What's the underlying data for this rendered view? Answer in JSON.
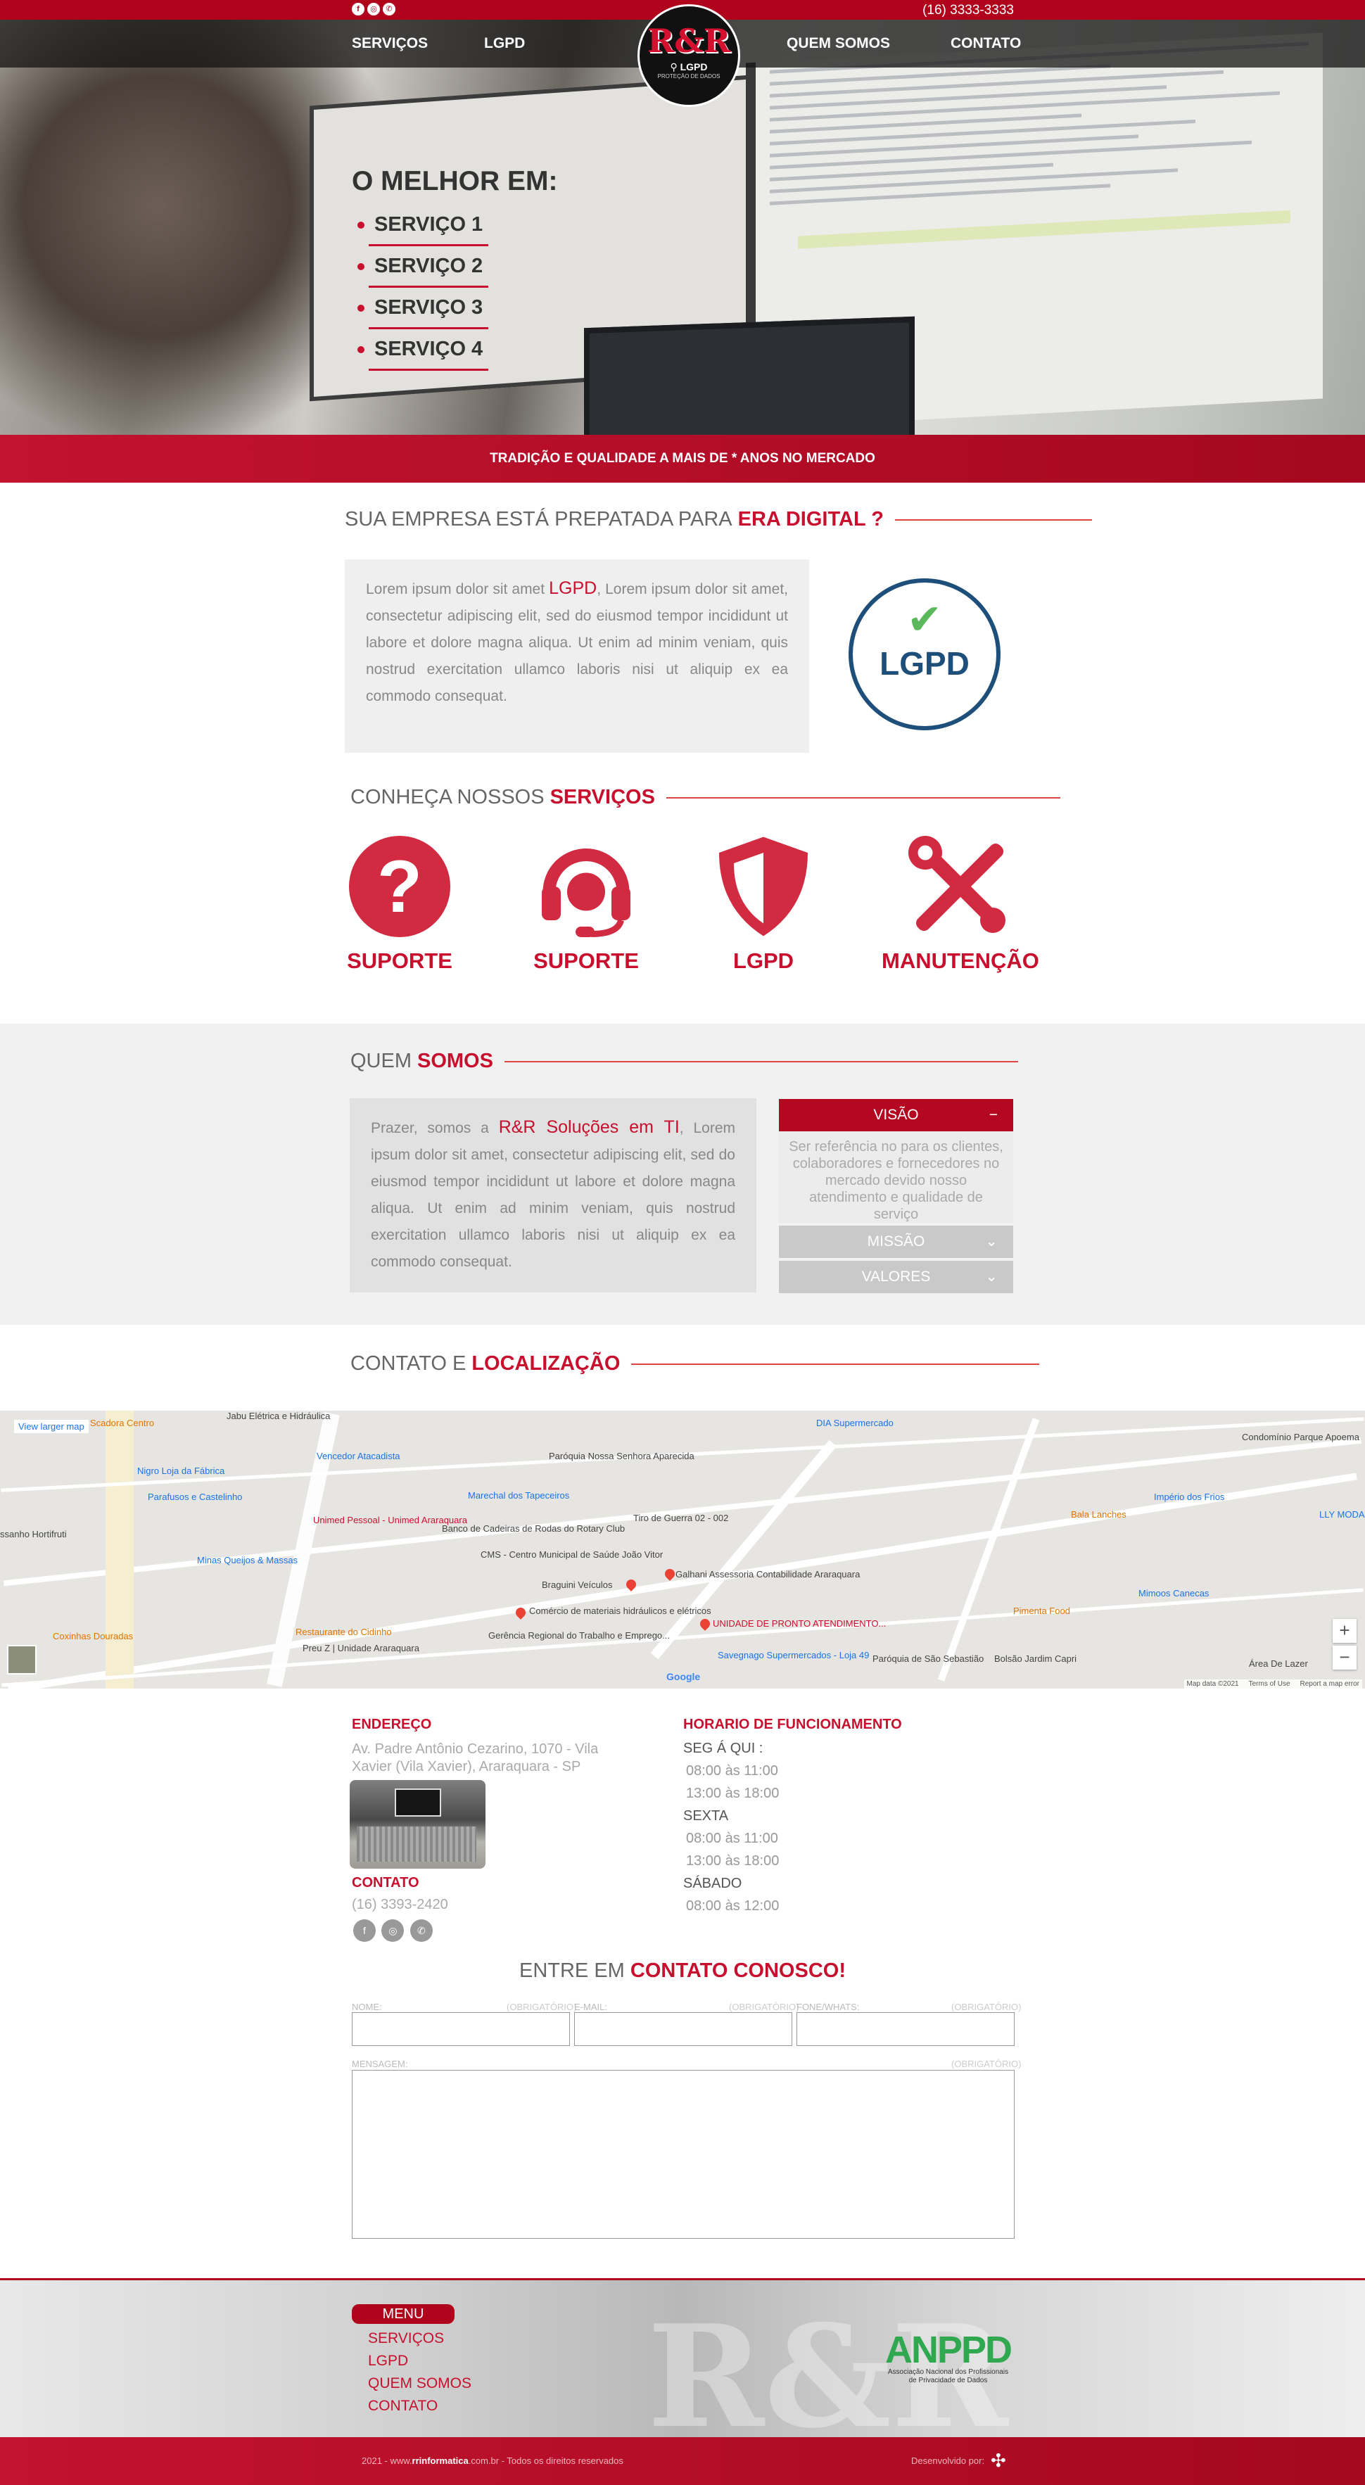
{
  "topbar": {
    "phone": "(16) 3333-3333",
    "social": [
      "f",
      "◎",
      "✆"
    ]
  },
  "nav": {
    "items": [
      "SERVIÇOS",
      "LGPD",
      "QUEM SOMOS",
      "CONTATO"
    ],
    "logo": {
      "mark": "R&R",
      "sub": "⚲ LGPD",
      "tag": "PROTEÇÃO DE DADOS"
    }
  },
  "hero": {
    "title": "O MELHOR EM:",
    "services": [
      "SERVIÇO 1",
      "SERVIÇO 2",
      "SERVIÇO 3",
      "SERVIÇO 4"
    ]
  },
  "tagline": "TRADIÇÃO E QUALIDADE A MAIS DE * ANOS NO MERCADO",
  "lgpd_section": {
    "heading": "SUA EMPRESA ESTÁ PREPATADA PARA",
    "heading_hl": "ERA DIGITAL ?",
    "text_pre": "Lorem ipsum dolor sit amet ",
    "text_hl": "LGPD",
    "text_post": ", Lorem ipsum dolor sit amet, consectetur adipiscing elit, sed do eiusmod tempor incididunt ut labore et dolore magna aliqua. Ut enim ad minim veniam, quis nostrud exercitation ullamco laboris nisi ut aliquip ex ea commodo consequat.",
    "badge_check": "✔",
    "badge_text": "LGPD"
  },
  "services_section": {
    "heading": "CONHEÇA NOSSOS",
    "heading_hl": "SERVIÇOS",
    "items": [
      {
        "label": "SUPORTE",
        "icon": "question-icon"
      },
      {
        "label": "SUPORTE",
        "icon": "headset-icon"
      },
      {
        "label": "LGPD",
        "icon": "shield-icon"
      },
      {
        "label": "MANUTENÇÃO",
        "icon": "tools-icon"
      }
    ]
  },
  "about": {
    "heading": "QUEM",
    "heading_hl": "SOMOS",
    "text_pre": "Prazer, somos a ",
    "text_hl": "R&R Soluções em TI",
    "text_post": ", Lorem ipsum dolor sit amet, consectetur adipiscing elit, sed do eiusmod tempor incididunt ut labore et dolore magna aliqua. Ut enim ad minim veniam, quis nostrud exercitation ullamco laboris nisi ut aliquip ex ea commodo consequat.",
    "accordion": [
      {
        "title": "VISÃO",
        "symbol": "−",
        "body": "Ser referência no para os clientes, colaboradores e fornecedores no mercado devido nosso atendimento e qualidade de serviço"
      },
      {
        "title": "MISSÃO",
        "symbol": "⌄"
      },
      {
        "title": "VALORES",
        "symbol": "⌄"
      }
    ]
  },
  "contact_heading": {
    "pre": "CONTATO E",
    "hl": "LOCALIZAÇÃO"
  },
  "map": {
    "view_larger": "View larger map",
    "labels": [
      "Jabu Elétrica e Hidráulica",
      "Vencedor Atacadista",
      "Nigro Loja da Fábrica",
      "Parafusos e Castelinho",
      "Paróquia Nossa Senhora Aparecida",
      "Marechal dos Tapeceiros",
      "Unimed Pessoal - Unimed Araraquara",
      "Banco de Cadeiras de Rodas do Rotary Club",
      "Tiro de Guerra 02 - 002",
      "CMS - Centro Municipal de Saúde João Vitor",
      "Minas Queijos & Massas",
      "Braguini Veículos",
      "Galhani Assessoria Contabilidade Araraquara",
      "Comércio de materiais hidráulicos e elétricos",
      "UNIDADE DE PRONTO ATENDIMENTO...",
      "Restaurante do Cidinho",
      "Gerência Regional do Trabalho e Emprego...",
      "Preu Z | Unidade Araraquara",
      "Coxinhas Douradas",
      "Savegnago Supermercados - Loja 49",
      "Paróquia de São Sebastião",
      "DIA Supermercado",
      "Condomínio Parque Apoema",
      "Império dos Frios",
      "Bala Lanches",
      "LLY MODA",
      "Mimoos Canecas",
      "Pimenta Food",
      "Bolsão Jardim Capri",
      "Área De Lazer",
      "ssanho Hortifruti",
      "Scadora Centro"
    ],
    "footer": [
      "Map data ©2021",
      "Terms of Use",
      "Report a map error"
    ],
    "google": "Google",
    "zoom_in": "+",
    "zoom_out": "−"
  },
  "address": {
    "title": "ENDEREÇO",
    "text": "Av. Padre Antônio Cezarino, 1070 - Vila Xavier (Vila Xavier), Araraquara - SP",
    "contact_title": "CONTATO",
    "phone": "(16) 3393-2420",
    "social": [
      "f",
      "◎",
      "✆"
    ]
  },
  "hours": {
    "title": "HORARIO DE FUNCIONAMENTO",
    "days": [
      {
        "day": "SEG Á QUI :",
        "times": [
          "08:00 às 11:00",
          "13:00 às 18:00"
        ]
      },
      {
        "day": "SEXTA",
        "times": [
          "08:00 às 11:00",
          "13:00 às 18:00"
        ]
      },
      {
        "day": "SÁBADO",
        "times": [
          "08:00 às 12:00"
        ]
      }
    ]
  },
  "form": {
    "heading": "ENTRE EM",
    "heading_hl": "CONTATO CONOSCO!",
    "fields": [
      {
        "label": "NOME:",
        "req": "(OBRIGATÓRIO)"
      },
      {
        "label": "E-MAIL:",
        "req": "(OBRIGATÓRIO)"
      },
      {
        "label": "FONE/WHATS:",
        "req": "(OBRIGATÓRIO)"
      }
    ],
    "message_label": "MENSAGEM:",
    "message_req": "(OBRIGATÓRIO)"
  },
  "footer": {
    "menu_title": "MENU",
    "menu": [
      "SERVIÇOS",
      "LGPD",
      "QUEM SOMOS",
      "CONTATO"
    ],
    "anppd": "ANPPD",
    "anppd_sub": "Associação Nacional dos Profissionais de Privacidade de Dados",
    "copyright_pre": "2021 - www.",
    "copyright_site": "rrinformatica",
    "copyright_post": ".com.br - Todos os direitos reservados",
    "dev": "Desenvolvido por:"
  },
  "colors": {
    "brand": "#c8102e",
    "dark_red": "#b0041d",
    "lgpd_blue": "#1d4f7a",
    "check_green": "#5cb85c",
    "anppd_green": "#2fa84f"
  }
}
